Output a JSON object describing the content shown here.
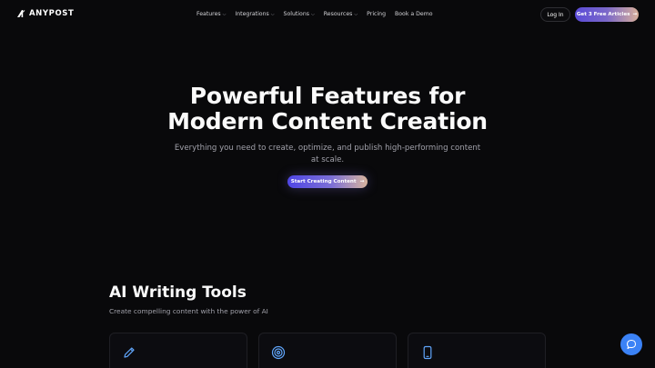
{
  "brand": {
    "name": "ANYPOST"
  },
  "nav": {
    "items": [
      {
        "label": "Features",
        "has_dropdown": true
      },
      {
        "label": "Integrations",
        "has_dropdown": true
      },
      {
        "label": "Solutions",
        "has_dropdown": true
      },
      {
        "label": "Resources",
        "has_dropdown": true
      },
      {
        "label": "Pricing",
        "has_dropdown": false
      },
      {
        "label": "Book a Demo",
        "has_dropdown": false
      }
    ],
    "login_label": "Log In",
    "cta_label": "Get 3 Free Articles",
    "cta_arrow": "→"
  },
  "hero": {
    "title_line1": "Powerful Features for",
    "title_line2": "Modern Content Creation",
    "subtitle": "Everything you need to create, optimize, and publish high-performing content at scale.",
    "cta_label": "Start Creating Content",
    "cta_arrow": "→"
  },
  "section": {
    "title": "AI Writing Tools",
    "subtitle": "Create compelling content with the power of AI",
    "cards": [
      {
        "icon": "pencil-icon"
      },
      {
        "icon": "target-icon"
      },
      {
        "icon": "smartphone-icon"
      }
    ]
  },
  "chat": {
    "icon": "chat-support-icon"
  },
  "colors": {
    "background": "#09090b",
    "accent_start": "#4f46e5",
    "accent_end": "#d8b49e",
    "icon_blue": "#60a5fa",
    "chat_button": "#3b82f6"
  }
}
